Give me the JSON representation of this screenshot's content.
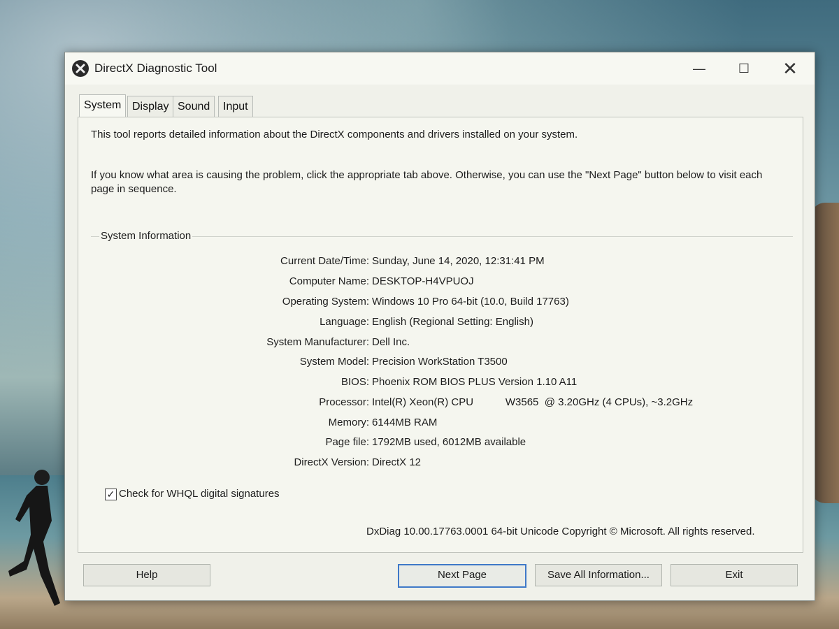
{
  "window": {
    "title": "DirectX Diagnostic Tool",
    "controls": {
      "minimize": "—",
      "maximize": "☐",
      "close": "✕"
    }
  },
  "tabs": [
    {
      "label": "System",
      "active": true
    },
    {
      "label": "Display",
      "active": false
    },
    {
      "label": "Sound",
      "active": false
    },
    {
      "label": "Input",
      "active": false
    }
  ],
  "intro": {
    "line1": "This tool reports detailed information about the DirectX components and drivers installed on your system.",
    "line2": "If you know what area is causing the problem, click the appropriate tab above.  Otherwise, you can use the \"Next Page\" button below to visit each page in sequence."
  },
  "system_info": {
    "group_label": "System Information",
    "rows": [
      {
        "key": "Current Date/Time:",
        "value": "Sunday, June 14, 2020, 12:31:41 PM"
      },
      {
        "key": "Computer Name:",
        "value": "DESKTOP-H4VPUOJ"
      },
      {
        "key": "Operating System:",
        "value": "Windows 10 Pro 64-bit (10.0, Build 17763)"
      },
      {
        "key": "Language:",
        "value": "English (Regional Setting: English)"
      },
      {
        "key": "System Manufacturer:",
        "value": "Dell Inc."
      },
      {
        "key": "System Model:",
        "value": "Precision WorkStation T3500"
      },
      {
        "key": "BIOS:",
        "value": "Phoenix ROM BIOS PLUS Version 1.10 A11"
      },
      {
        "key": "Processor:",
        "value": "Intel(R) Xeon(R) CPU           W3565  @ 3.20GHz (4 CPUs), ~3.2GHz"
      },
      {
        "key": "Memory:",
        "value": "6144MB RAM"
      },
      {
        "key": "Page file:",
        "value": "1792MB used, 6012MB available"
      },
      {
        "key": "DirectX Version:",
        "value": "DirectX 12"
      }
    ]
  },
  "whql": {
    "label": "Check for WHQL digital signatures",
    "checked": true,
    "mark": "✓"
  },
  "footer": "DxDiag 10.00.17763.0001 64-bit Unicode  Copyright © Microsoft. All rights reserved.",
  "buttons": {
    "help": "Help",
    "next": "Next Page",
    "save": "Save All Information...",
    "exit": "Exit"
  },
  "colors": {
    "accent": "#3f79c8",
    "window_bg": "#f0f1ea"
  },
  "icons": {
    "app": "directx-x-icon"
  }
}
